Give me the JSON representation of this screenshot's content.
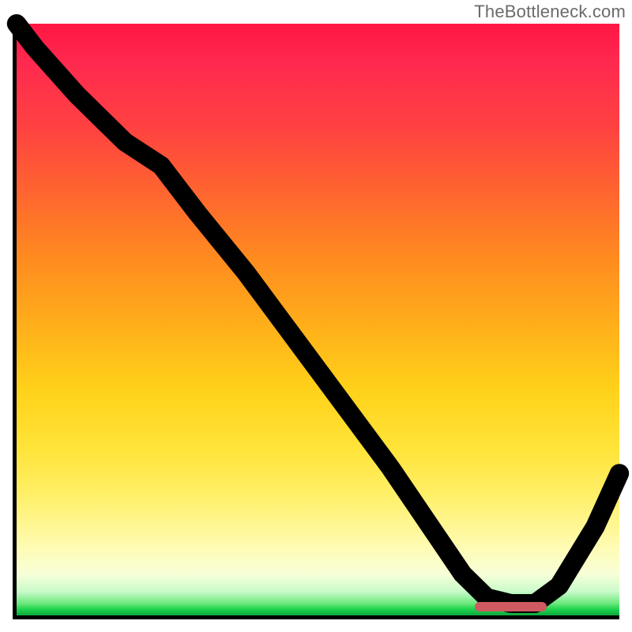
{
  "watermark": "TheBottleneck.com",
  "colors": {
    "gradient_top": "#ff1744",
    "gradient_mid": "#ffd21a",
    "gradient_bottom": "#0fa83d",
    "axis": "#000000",
    "curve": "#000000",
    "indicator": "#cf5a62"
  },
  "chart_data": {
    "type": "line",
    "title": "",
    "xlabel": "",
    "ylabel": "",
    "xlim": [
      0,
      100
    ],
    "ylim": [
      0,
      100
    ],
    "x": [
      0,
      3,
      10,
      18,
      24,
      30,
      38,
      46,
      54,
      62,
      70,
      74,
      78,
      82,
      86,
      90,
      96,
      100
    ],
    "values": [
      100,
      96,
      88,
      80,
      76,
      68,
      58,
      47,
      36,
      25,
      13,
      7,
      3,
      2,
      2,
      5,
      15,
      24
    ],
    "indicator": {
      "x_start": 76,
      "x_end": 88,
      "y": 1.5
    },
    "grid": false,
    "legend": null
  }
}
